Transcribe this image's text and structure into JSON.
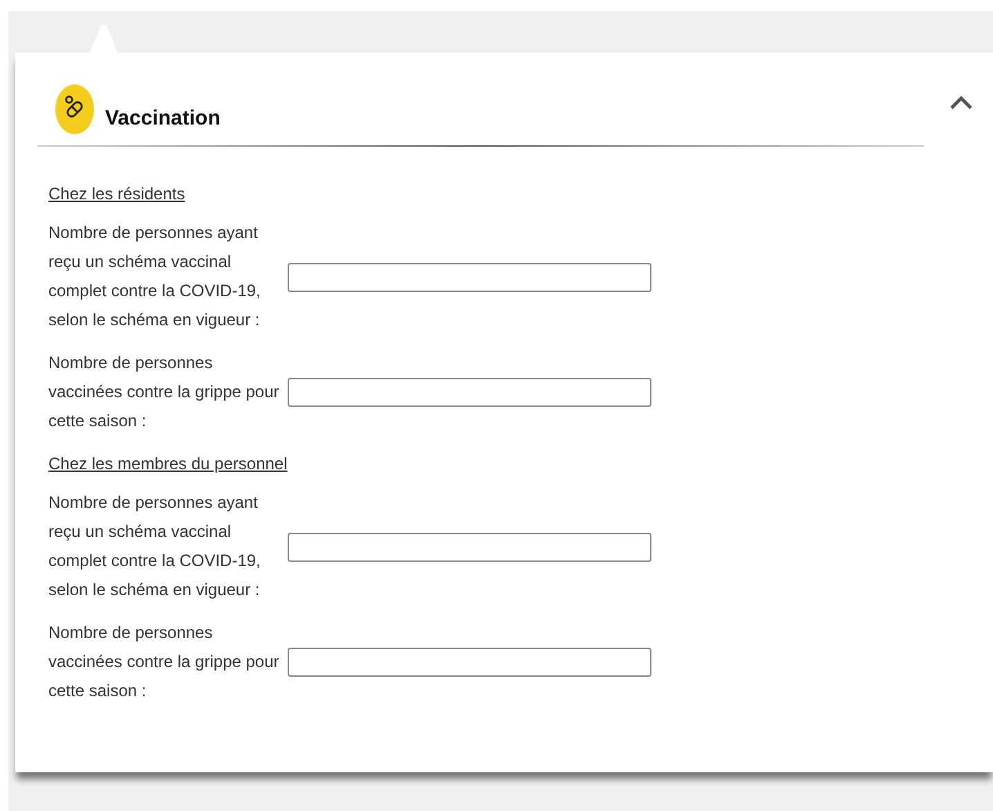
{
  "panel": {
    "title": "Vaccination",
    "expanded": true
  },
  "sections": [
    {
      "heading": "Chez les résidents",
      "fields": [
        {
          "label": "Nombre de personnes ayant reçu un schéma vaccinal complet contre la COVID-19, selon le schéma en vigueur :"
        },
        {
          "label": "Nombre de personnes vaccinées contre la grippe pour cette saison :"
        }
      ]
    },
    {
      "heading": "Chez les membres du personnel",
      "fields": [
        {
          "label": "Nombre de personnes ayant reçu un schéma vaccinal complet contre la COVID-19, selon le schéma en vigueur :"
        },
        {
          "label": "Nombre de personnes vaccinées contre la grippe pour cette saison :"
        }
      ]
    }
  ]
}
